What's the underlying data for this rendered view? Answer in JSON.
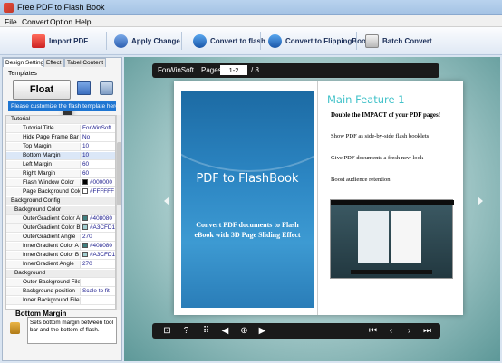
{
  "window": {
    "title": "Free PDF to Flash Book"
  },
  "menu": {
    "items": [
      "File",
      "Convert",
      "Option",
      "Help"
    ]
  },
  "toolbar": {
    "import_pdf": "Import PDF",
    "apply_change": "Apply Change",
    "convert_flash": "Convert to flash",
    "convert_flippingbook": "Convert to FlippingBook",
    "batch_convert": "Batch Convert"
  },
  "left_panel": {
    "tabs": [
      "Design Setting",
      "Effect",
      "Tabel Content"
    ],
    "templates_label": "Templates",
    "float_button": "Float",
    "customize_hint": "Please customize the flash template here",
    "properties": [
      {
        "type": "section",
        "label": "Tutorial"
      },
      {
        "type": "prop",
        "key": "Tutorial Title",
        "value": "ForWinSoft"
      },
      {
        "type": "prop",
        "key": "Hide Page Frame Bar",
        "value": "No"
      },
      {
        "type": "prop",
        "key": "Top Margin",
        "value": "10"
      },
      {
        "type": "prop",
        "key": "Bottom Margin",
        "value": "10",
        "selected": true
      },
      {
        "type": "prop",
        "key": "Left Margin",
        "value": "60"
      },
      {
        "type": "prop",
        "key": "Right Margin",
        "value": "60"
      },
      {
        "type": "prop",
        "key": "Flash Window Color",
        "value": "#000000",
        "swatch": "#000000"
      },
      {
        "type": "prop",
        "key": "Page Background Color",
        "value": "#FFFFFF",
        "swatch": "#FFFFFF"
      },
      {
        "type": "section",
        "label": "Background Config"
      },
      {
        "type": "sub",
        "label": "Background Color"
      },
      {
        "type": "prop",
        "key": "OuterGradient Color A",
        "value": "#408080",
        "swatch": "#408080"
      },
      {
        "type": "prop",
        "key": "OuterGradient Color B",
        "value": "#A3CFD1",
        "swatch": "#A3CFD1"
      },
      {
        "type": "prop",
        "key": "OuterGradient Angle",
        "value": "270"
      },
      {
        "type": "prop",
        "key": "InnerGradient Color A",
        "value": "#408080",
        "swatch": "#408080"
      },
      {
        "type": "prop",
        "key": "InnerGradient Color B",
        "value": "#A3CFD1",
        "swatch": "#A3CFD1"
      },
      {
        "type": "prop",
        "key": "InnerGradient Angle",
        "value": "270"
      },
      {
        "type": "sub",
        "label": "Background"
      },
      {
        "type": "prop",
        "key": "Outer Background File",
        "value": ""
      },
      {
        "type": "prop",
        "key": "Background position",
        "value": "Scale to fit"
      },
      {
        "type": "prop",
        "key": "Inner Background File",
        "value": ""
      }
    ],
    "description_title": "Bottom Margin",
    "description_text": "Sets bottom margin between tool bar and the bottom of flash."
  },
  "preview": {
    "brand": "ForWinSoft",
    "pages_label": "Pages:",
    "page_value": "1-2",
    "page_total": "/ 8",
    "cover_title": "PDF to FlashBook",
    "cover_subtitle": "Convert PDF documents to Flash eBook with 3D Page Sliding Effect",
    "feature_title": "Main Feature 1",
    "features": [
      "Double the IMPACT of your PDF pages!",
      "Show PDF as side-by-side flash booklets",
      "Give PDF documents a fresh new look",
      "Boost audience retention"
    ]
  }
}
